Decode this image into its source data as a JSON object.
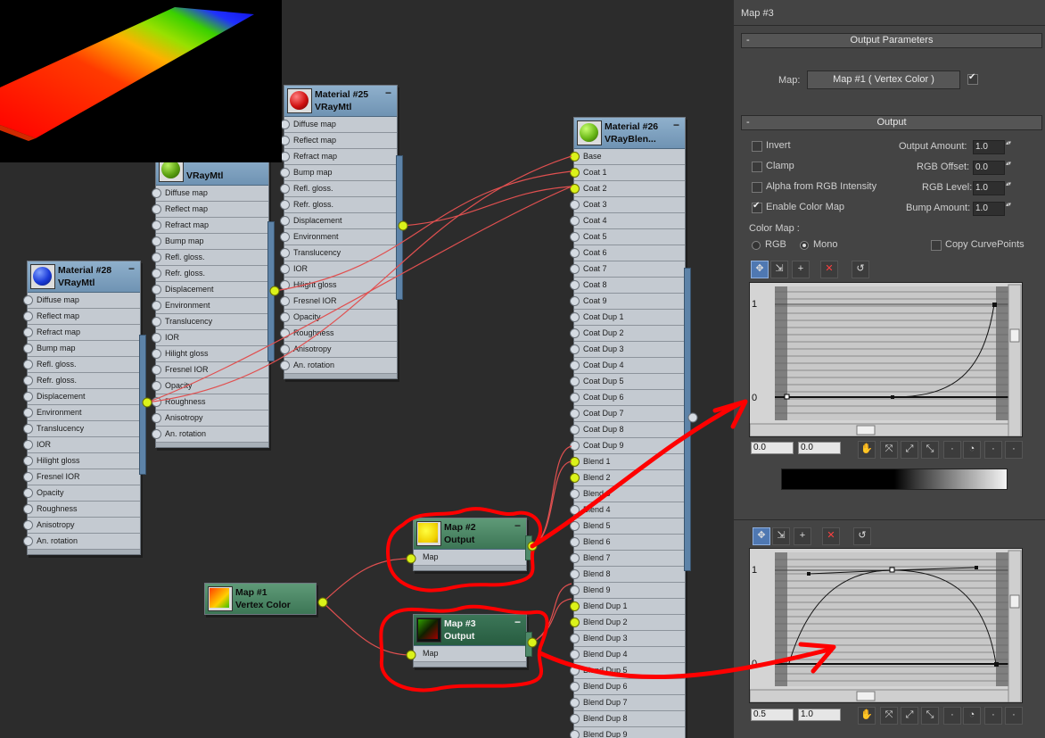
{
  "canvas": {
    "nodes": {
      "mat25": {
        "name": "Material #25",
        "type": "VRayMtl"
      },
      "mat26": {
        "name": "Material #26",
        "type": "VRayBlen..."
      },
      "mat28": {
        "name": "Material #28",
        "type": "VRayMtl"
      },
      "matmid": {
        "type": "VRayMtl"
      },
      "map1": {
        "name": "Map #1",
        "type": "Vertex Color"
      },
      "map2": {
        "name": "Map #2",
        "type": "Output",
        "slot": "Map"
      },
      "map3": {
        "name": "Map #3",
        "type": "Output",
        "slot": "Map"
      }
    },
    "vraymtl_slots": [
      "Diffuse map",
      "Reflect map",
      "Refract map",
      "Bump map",
      "Refl. gloss.",
      "Refr. gloss.",
      "Displacement",
      "Environment",
      "Translucency",
      "IOR",
      "Hilight gloss",
      "Fresnel IOR",
      "Opacity",
      "Roughness",
      "Anisotropy",
      "An. rotation"
    ],
    "blend_slots": [
      "Base",
      "Coat 1",
      "Coat 2",
      "Coat 3",
      "Coat 4",
      "Coat 5",
      "Coat 6",
      "Coat 7",
      "Coat 8",
      "Coat 9",
      "Coat Dup 1",
      "Coat Dup 2",
      "Coat Dup 3",
      "Coat Dup 4",
      "Coat Dup 5",
      "Coat Dup 6",
      "Coat Dup 7",
      "Coat Dup 8",
      "Coat Dup 9",
      "Blend 1",
      "Blend 2",
      "Blend 3",
      "Blend 4",
      "Blend 5",
      "Blend 6",
      "Blend 7",
      "Blend 8",
      "Blend 9",
      "Blend Dup 1",
      "Blend Dup 2",
      "Blend Dup 3",
      "Blend Dup 4",
      "Blend Dup 5",
      "Blend Dup 6",
      "Blend Dup 7",
      "Blend Dup 8",
      "Blend Dup 9"
    ]
  },
  "panel": {
    "title": "Map #3",
    "output_params": {
      "header": "Output Parameters",
      "map_label": "Map:",
      "map_value": "Map #1  ( Vertex Color )",
      "map_checked": true
    },
    "output": {
      "header": "Output",
      "invert": {
        "label": "Invert",
        "checked": false
      },
      "clamp": {
        "label": "Clamp",
        "checked": false
      },
      "alpha": {
        "label": "Alpha from RGB Intensity",
        "checked": false
      },
      "enable_color_map": {
        "label": "Enable Color Map",
        "checked": true
      },
      "output_amount": {
        "label": "Output Amount:",
        "value": "1.0"
      },
      "rgb_offset": {
        "label": "RGB Offset:",
        "value": "0.0"
      },
      "rgb_level": {
        "label": "RGB Level:",
        "value": "1.0"
      },
      "bump_amount": {
        "label": "Bump Amount:",
        "value": "1.0"
      }
    },
    "color_map": {
      "label": "Color Map :",
      "rgb": "RGB",
      "mono": "Mono",
      "mode": "Mono",
      "copy_curve_points": "Copy CurvePoints",
      "axis_top": "1",
      "axis_bottom": "0",
      "graph1": {
        "x_field": "0.0",
        "y_field": "0.0"
      },
      "graph2": {
        "x_field": "0.5",
        "y_field": "1.0"
      }
    }
  },
  "colors": {
    "wire": "#e03a3a",
    "annotation": "#ff0000",
    "port_active": "#dbf21a",
    "node_header": "#7a9dbd",
    "output_header": "#4a8464"
  }
}
